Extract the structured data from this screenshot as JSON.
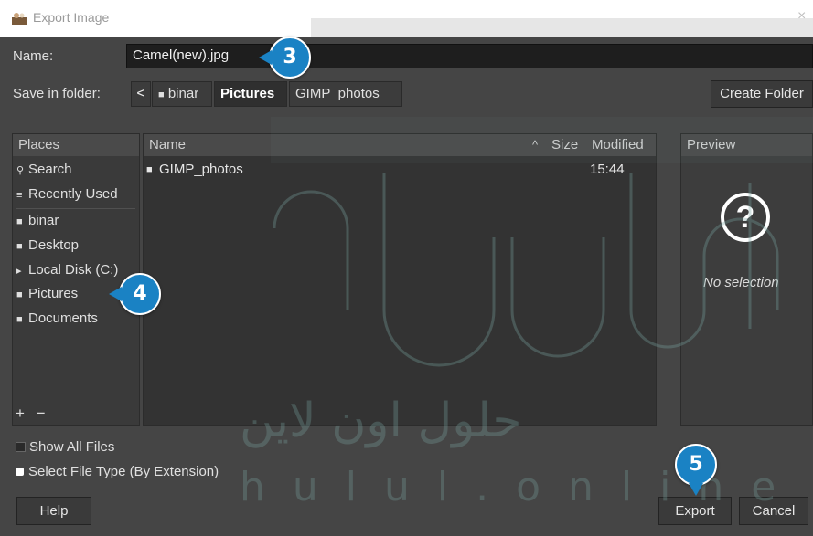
{
  "window": {
    "title": "Export Image",
    "close_glyph": "×"
  },
  "name_row": {
    "label": "Name:",
    "value": "Camel(new).jpg"
  },
  "folder_row": {
    "label": "Save in folder:",
    "back_glyph": "<",
    "crumbs": [
      {
        "label": "binar",
        "icon": "folder-icon"
      },
      {
        "label": "Pictures",
        "active": true
      },
      {
        "label": "GIMP_photos"
      }
    ],
    "create_folder": "Create Folder"
  },
  "places": {
    "header": "Places",
    "items": [
      {
        "label": "Search",
        "icon": "search-icon"
      },
      {
        "label": "Recently Used",
        "icon": "recent-icon"
      },
      {
        "label": "binar",
        "icon": "folder-icon"
      },
      {
        "label": "Desktop",
        "icon": "folder-icon"
      },
      {
        "label": "Local Disk (C:)",
        "icon": "drive-icon"
      },
      {
        "label": "Pictures",
        "icon": "folder-icon"
      },
      {
        "label": "Documents",
        "icon": "folder-icon"
      }
    ],
    "add_glyph": "+",
    "remove_glyph": "−"
  },
  "files": {
    "columns": {
      "name": "Name",
      "sort_glyph": "^",
      "size": "Size",
      "modified": "Modified"
    },
    "rows": [
      {
        "name": "GIMP_photos",
        "size": "",
        "modified": "15:44"
      }
    ]
  },
  "preview": {
    "header": "Preview",
    "glyph": "?",
    "no_selection": "No selection"
  },
  "options": {
    "show_all_files": "Show All Files",
    "select_file_type": "Select File Type (By Extension)"
  },
  "buttons": {
    "help": "Help",
    "export": "Export",
    "cancel": "Cancel"
  },
  "callouts": {
    "name": "3",
    "pictures": "4",
    "export": "5"
  },
  "watermark": {
    "text_latin": "hulul.online",
    "text_arabic": "حلول اون لاين"
  },
  "colors": {
    "dialog_bg": "#454545",
    "callout": "#1a82c4",
    "input_bg": "#1e1e1e"
  }
}
